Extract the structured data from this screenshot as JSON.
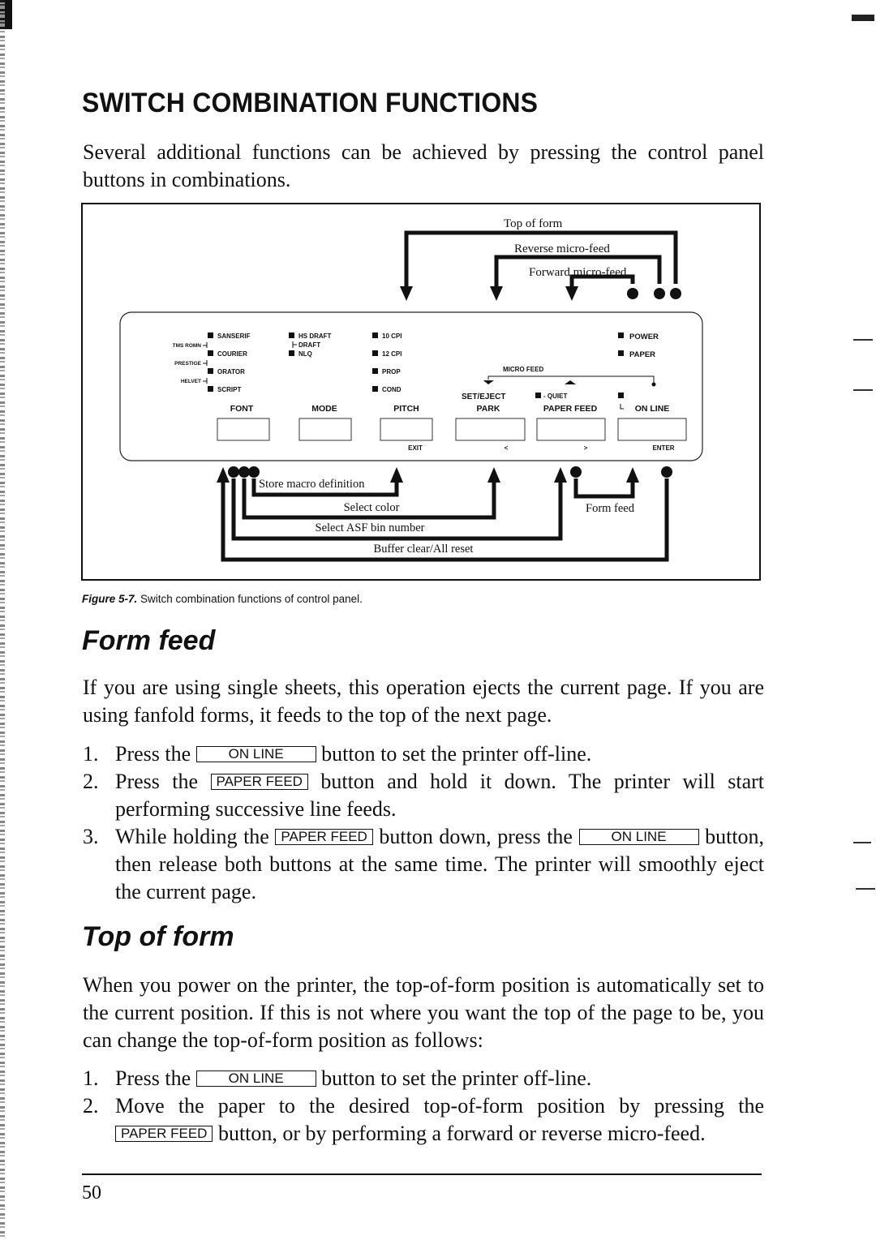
{
  "heading": "SWITCH COMBINATION FUNCTIONS",
  "intro": "Several additional functions can be achieved by pressing the control panel buttons in combinations.",
  "figure": {
    "caption_label": "Figure 5-7.",
    "caption_text": "Switch combination functions of control panel.",
    "top_annotations": {
      "top_of_form": "Top of form",
      "reverse_micro_feed": "Reverse micro-feed",
      "forward_micro_feed": "Forward micro-feed"
    },
    "bottom_annotations": {
      "store_macro": "Store macro definition",
      "select_color": "Select color",
      "select_asf": "Select ASF bin number",
      "buffer_clear": "Buffer clear/All reset",
      "form_feed": "Form feed"
    },
    "panel": {
      "font_indicators": [
        "SANSERIF",
        "COURIER",
        "ORATOR",
        "SCRIPT"
      ],
      "font_between": [
        "TMS ROMN",
        "PRESTIGE",
        "HELVET"
      ],
      "mode_indicators": [
        "HS DRAFT",
        "NLQ"
      ],
      "mode_between": "DRAFT",
      "pitch_indicators": [
        "10 CPI",
        "12 CPI",
        "PROP",
        "COND"
      ],
      "status_indicators": [
        "POWER",
        "PAPER"
      ],
      "micro_feed_label": "MICRO FEED",
      "quiet_label": "- QUIET",
      "buttons": [
        {
          "label": "FONT",
          "sublabel": ""
        },
        {
          "label": "MODE",
          "sublabel": ""
        },
        {
          "label": "PITCH",
          "sublabel": "EXIT"
        },
        {
          "label": "PARK",
          "top_label": "SET/EJECT",
          "sublabel": "<"
        },
        {
          "label": "PAPER FEED",
          "sublabel": ">"
        },
        {
          "label": "ON LINE",
          "sublabel": "ENTER"
        }
      ]
    }
  },
  "form_feed": {
    "title": "Form feed",
    "paragraph": "If you are using single sheets, this operation ejects the current page. If you are using fanfold forms, it feeds to the top of the next page.",
    "steps": [
      {
        "num": "1.",
        "pre": "Press the",
        "key": "ON LINE",
        "post": "button to set the printer off-line."
      },
      {
        "num": "2.",
        "pre": "Press the",
        "key": "PAPER FEED",
        "post": "button and hold it down. The printer will start performing successive line feeds."
      },
      {
        "num": "3.",
        "pre": "While holding the",
        "key": "PAPER FEED",
        "mid": "button down, press the",
        "key2": "ON LINE",
        "post": "button, then release both buttons at the same time. The printer will smoothly eject the current page."
      }
    ]
  },
  "top_of_form": {
    "title": "Top of form",
    "paragraph": "When you power on the printer, the top-of-form position is automatically set to the current position. If this is not where you want the top of the page to be, you can change the top-of-form position as follows:",
    "steps": [
      {
        "num": "1.",
        "pre": "Press the",
        "key": "ON LINE",
        "post": "button to set the printer off-line."
      },
      {
        "num": "2.",
        "pre": "Move the paper to the desired top-of-form position by pressing the",
        "key": "PAPER FEED",
        "post": "button, or by performing a forward or reverse micro-feed."
      }
    ]
  },
  "page_number": "50"
}
